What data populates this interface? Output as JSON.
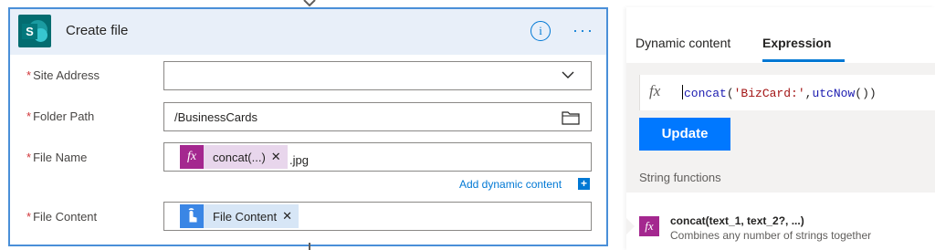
{
  "card": {
    "title": "Create file",
    "fields": [
      {
        "label": "Site Address",
        "value": ""
      },
      {
        "label": "Folder Path",
        "value": "/BusinessCards"
      },
      {
        "label": "File Name",
        "token": "concat(...)",
        "suffix": ".jpg"
      },
      {
        "label": "File Content",
        "token": "File Content"
      }
    ],
    "required_mark": "*",
    "add_dynamic_content": "Add dynamic content",
    "token_close": "✕"
  },
  "pane": {
    "tabs": [
      "Dynamic content",
      "Expression"
    ],
    "active_tab": "Expression",
    "expression": {
      "fn1": "concat",
      "open": "(",
      "str": "'BizCard:'",
      "comma": ",",
      "fn2": "utcNow",
      "close": "())"
    },
    "update_label": "Update",
    "section_title": "String functions",
    "functions": [
      {
        "name": "concat(text_1, text_2?, ...)",
        "description": "Combines any number of strings together"
      }
    ]
  },
  "colors": {
    "accent": "#0078d4",
    "card_border": "#4a8fd8",
    "header_bg": "#e8eff9",
    "expression_token": "#a4278f",
    "dynamic_token": "#3a86e5",
    "update_button": "#0078ff",
    "required": "#d13438"
  },
  "icons": [
    "sharepoint-icon",
    "info-icon",
    "more-icon",
    "chevron-down-icon",
    "folder-icon",
    "fx-icon",
    "hand-pointer-icon",
    "plus-icon"
  ]
}
